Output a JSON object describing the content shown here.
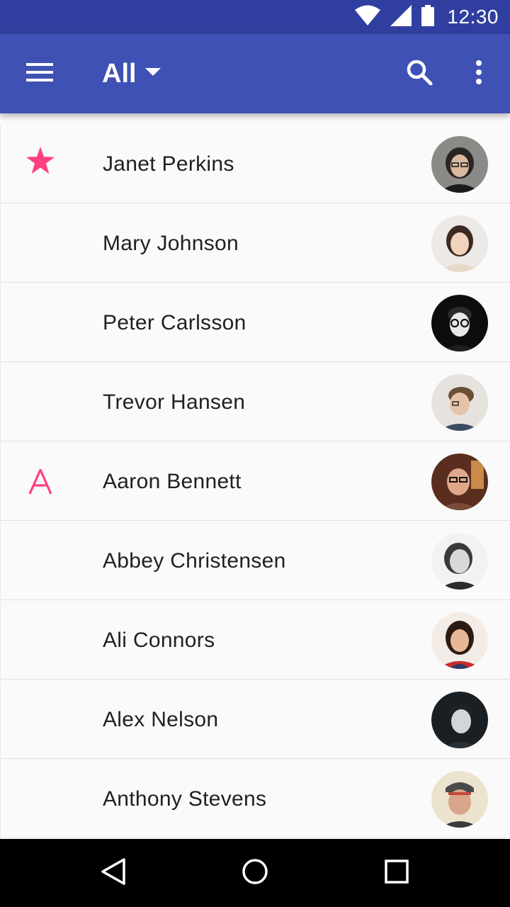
{
  "status_bar": {
    "time": "12:30",
    "icons": [
      "wifi-icon",
      "cell-signal-icon",
      "battery-icon"
    ]
  },
  "app_bar": {
    "title": "All",
    "icons": [
      "menu-icon",
      "dropdown-arrow-icon",
      "search-icon",
      "more-vert-icon"
    ],
    "color": "#3f51b5",
    "status_color": "#303f9f"
  },
  "contacts": [
    {
      "name": "Janet Perkins",
      "lead": "star-icon"
    },
    {
      "name": "Mary Johnson",
      "lead": ""
    },
    {
      "name": "Peter Carlsson",
      "lead": ""
    },
    {
      "name": "Trevor Hansen",
      "lead": ""
    },
    {
      "name": "Aaron Bennett",
      "lead": "A"
    },
    {
      "name": "Abbey Christensen",
      "lead": ""
    },
    {
      "name": "Ali Connors",
      "lead": ""
    },
    {
      "name": "Alex Nelson",
      "lead": ""
    },
    {
      "name": "Anthony Stevens",
      "lead": ""
    }
  ],
  "accent_color": "#ff4081",
  "nav_bar": {
    "icons": [
      "back-icon",
      "home-icon",
      "recents-icon"
    ]
  }
}
